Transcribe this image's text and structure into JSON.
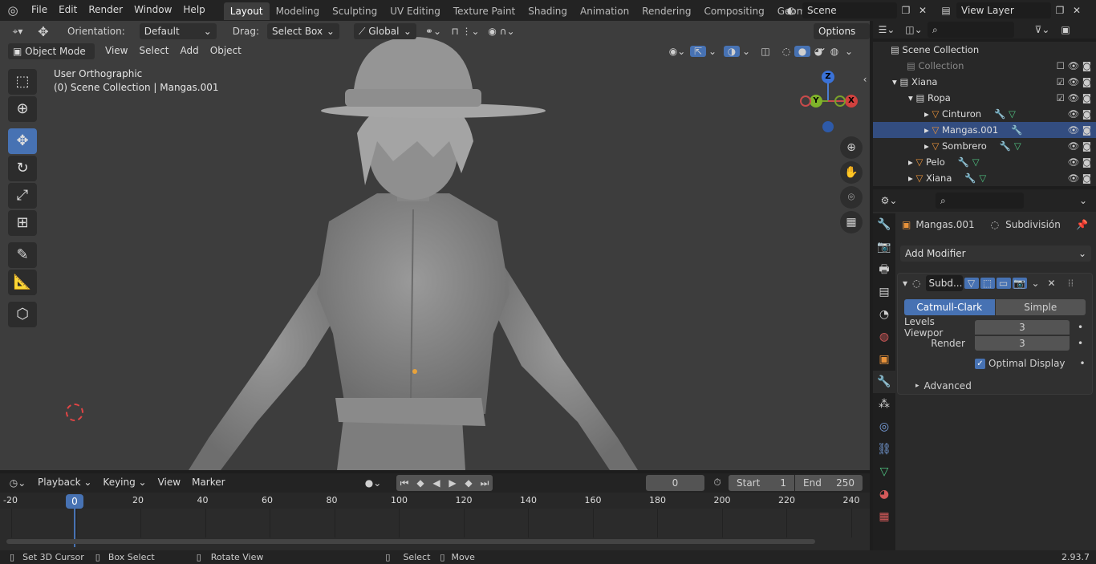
{
  "topbar": {
    "menus": [
      "File",
      "Edit",
      "Render",
      "Window",
      "Help"
    ],
    "workspaces": [
      "Layout",
      "Modeling",
      "Sculpting",
      "UV Editing",
      "Texture Paint",
      "Shading",
      "Animation",
      "Rendering",
      "Compositing",
      "Geometry Nod"
    ],
    "scene": "Scene",
    "view_layer": "View Layer"
  },
  "viewport": {
    "orientation_label": "Orientation:",
    "orientation": "Default",
    "drag_label": "Drag:",
    "drag": "Select Box",
    "transform": "Global",
    "options": "Options",
    "mode": "Object Mode",
    "menus": [
      "View",
      "Select",
      "Add",
      "Object"
    ],
    "overlay_title": "User Orthographic",
    "overlay_sub": "(0) Scene Collection | Mangas.001",
    "gizmo": {
      "z": "Z",
      "y": "Y",
      "x": "X"
    }
  },
  "outliner": {
    "rows": [
      {
        "label": "Scene Collection"
      },
      {
        "label": "Collection"
      },
      {
        "label": "Xiana"
      },
      {
        "label": "Ropa"
      },
      {
        "label": "Cinturon"
      },
      {
        "label": "Mangas.001"
      },
      {
        "label": "Sombrero"
      },
      {
        "label": "Pelo"
      },
      {
        "label": "Xiana"
      }
    ]
  },
  "properties": {
    "object": "Mangas.001",
    "modifier_name": "Subdivisión",
    "add_modifier": "Add Modifier",
    "mod_short": "Subd...",
    "catmull": "Catmull-Clark",
    "simple": "Simple",
    "levels_label": "Levels Viewpor",
    "levels_value": "3",
    "render_label": "Render",
    "render_value": "3",
    "optimal": "Optimal Display",
    "advanced": "Advanced"
  },
  "timeline": {
    "menus": [
      "Playback",
      "Keying",
      "View",
      "Marker"
    ],
    "current": "0",
    "start_label": "Start",
    "start": "1",
    "end_label": "End",
    "end": "250",
    "ticks": [
      "-20",
      "0",
      "20",
      "40",
      "60",
      "80",
      "100",
      "120",
      "140",
      "160",
      "180",
      "200",
      "220",
      "240"
    ],
    "playhead": "0"
  },
  "status": {
    "items": [
      "Set 3D Cursor",
      "Box Select",
      "Rotate View",
      "Select",
      "Move"
    ],
    "version": "2.93.7"
  }
}
